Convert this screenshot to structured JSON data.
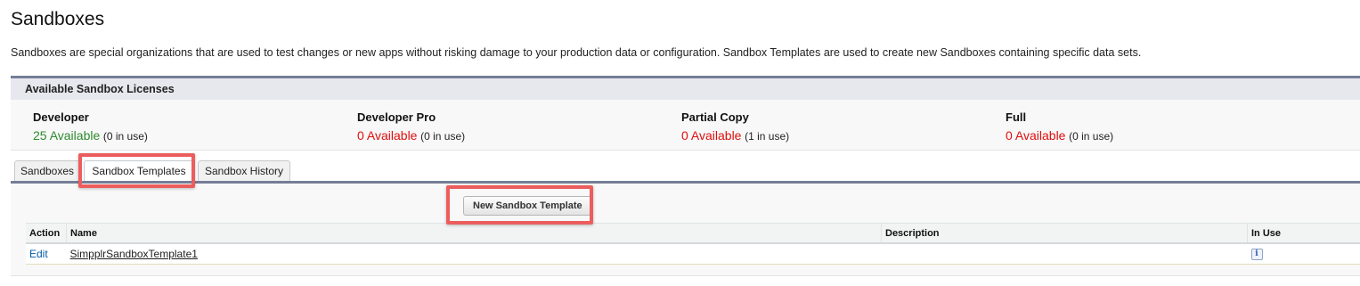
{
  "page": {
    "title": "Sandboxes",
    "description": "Sandboxes are special organizations that are used to test changes or new apps without risking damage to your production data or configuration. Sandbox Templates are used to create new Sandboxes containing specific data sets."
  },
  "licenses": {
    "header": "Available Sandbox Licenses",
    "items": [
      {
        "name": "Developer",
        "available": "25 Available",
        "in_use": "(0 in use)",
        "color": "#2e8a2e"
      },
      {
        "name": "Developer Pro",
        "available": "0 Available",
        "in_use": "(0 in use)",
        "color": "#e00f0f"
      },
      {
        "name": "Partial Copy",
        "available": "0 Available",
        "in_use": "(1 in use)",
        "color": "#e00f0f"
      },
      {
        "name": "Full",
        "available": "0 Available",
        "in_use": "(0 in use)",
        "color": "#e00f0f"
      }
    ]
  },
  "tabs": [
    {
      "label": "Sandboxes",
      "active": false
    },
    {
      "label": "Sandbox Templates",
      "active": true
    },
    {
      "label": "Sandbox History",
      "active": false
    }
  ],
  "templates": {
    "new_button_label": "New Sandbox Template",
    "columns": [
      "Action",
      "Name",
      "Description",
      "In Use"
    ],
    "rows": [
      {
        "action": "Edit",
        "name": "SimpplrSandboxTemplate1",
        "description": "",
        "in_use_icon": "info-icon",
        "in_use_glyph": "i"
      }
    ]
  },
  "colors": {
    "accent_bar": "#747e96",
    "highlight": "#ec5d5d",
    "link": "#015ba7"
  }
}
